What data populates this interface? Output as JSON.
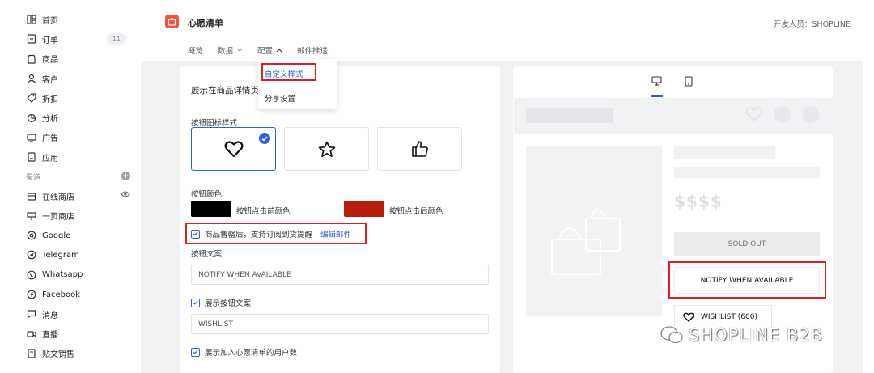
{
  "sidebar": {
    "items": [
      {
        "label": "首页",
        "icon": "dashboard-icon"
      },
      {
        "label": "订单",
        "icon": "order-icon",
        "badge": "11"
      },
      {
        "label": "商品",
        "icon": "product-icon"
      },
      {
        "label": "客户",
        "icon": "customer-icon"
      },
      {
        "label": "折扣",
        "icon": "discount-icon"
      },
      {
        "label": "分析",
        "icon": "analytics-icon"
      },
      {
        "label": "广告",
        "icon": "ads-icon"
      },
      {
        "label": "应用",
        "icon": "apps-icon"
      }
    ],
    "section_label": "渠道",
    "channels": [
      {
        "label": "在线商店",
        "icon": "store-icon"
      },
      {
        "label": "一页商店",
        "icon": "one-page-icon"
      },
      {
        "label": "Google",
        "icon": "google-icon"
      },
      {
        "label": "Telegram",
        "icon": "telegram-icon"
      },
      {
        "label": "Whatsapp",
        "icon": "whatsapp-icon"
      },
      {
        "label": "Facebook",
        "icon": "facebook-icon"
      },
      {
        "label": "消息",
        "icon": "message-icon"
      },
      {
        "label": "直播",
        "icon": "live-icon"
      },
      {
        "label": "贴文销售",
        "icon": "post-sales-icon"
      }
    ]
  },
  "header": {
    "app_title": "心愿清单",
    "developer": "开发人员：SHOPLINE",
    "tabs": [
      "概览",
      "数据",
      "配置",
      "邮件推送"
    ]
  },
  "dropdown": {
    "items": [
      "自定义样式",
      "分享设置"
    ]
  },
  "settings": {
    "title": "展示在商品详情页",
    "icon_style_label": "按钮图标样式",
    "color_label": "按钮颜色",
    "before_click_label": "按钮点击前颜色",
    "after_click_label": "按钮点击后颜色",
    "before_color": "#000000",
    "after_color": "#b81c0c",
    "subscribe_label": "商品售罄后，支持订阅到货提醒",
    "edit_email_link": "编辑邮件",
    "button_text_label": "按钮文案",
    "button_text_value": "NOTIFY WHEN AVAILABLE",
    "show_button_text_label": "展示按钮文案",
    "wishlist_text_value": "WISHLIST",
    "show_users_label": "展示加入心愿清单的用户数"
  },
  "preview": {
    "price": "$$$$",
    "sold_out": "SOLD OUT",
    "notify": "NOTIFY WHEN AVAILABLE",
    "wishlist": "WISHLIST (600)"
  },
  "watermark": "SHOPLINE B2B",
  "colors": {
    "accent": "#2d61e0",
    "highlight": "#e02020"
  }
}
